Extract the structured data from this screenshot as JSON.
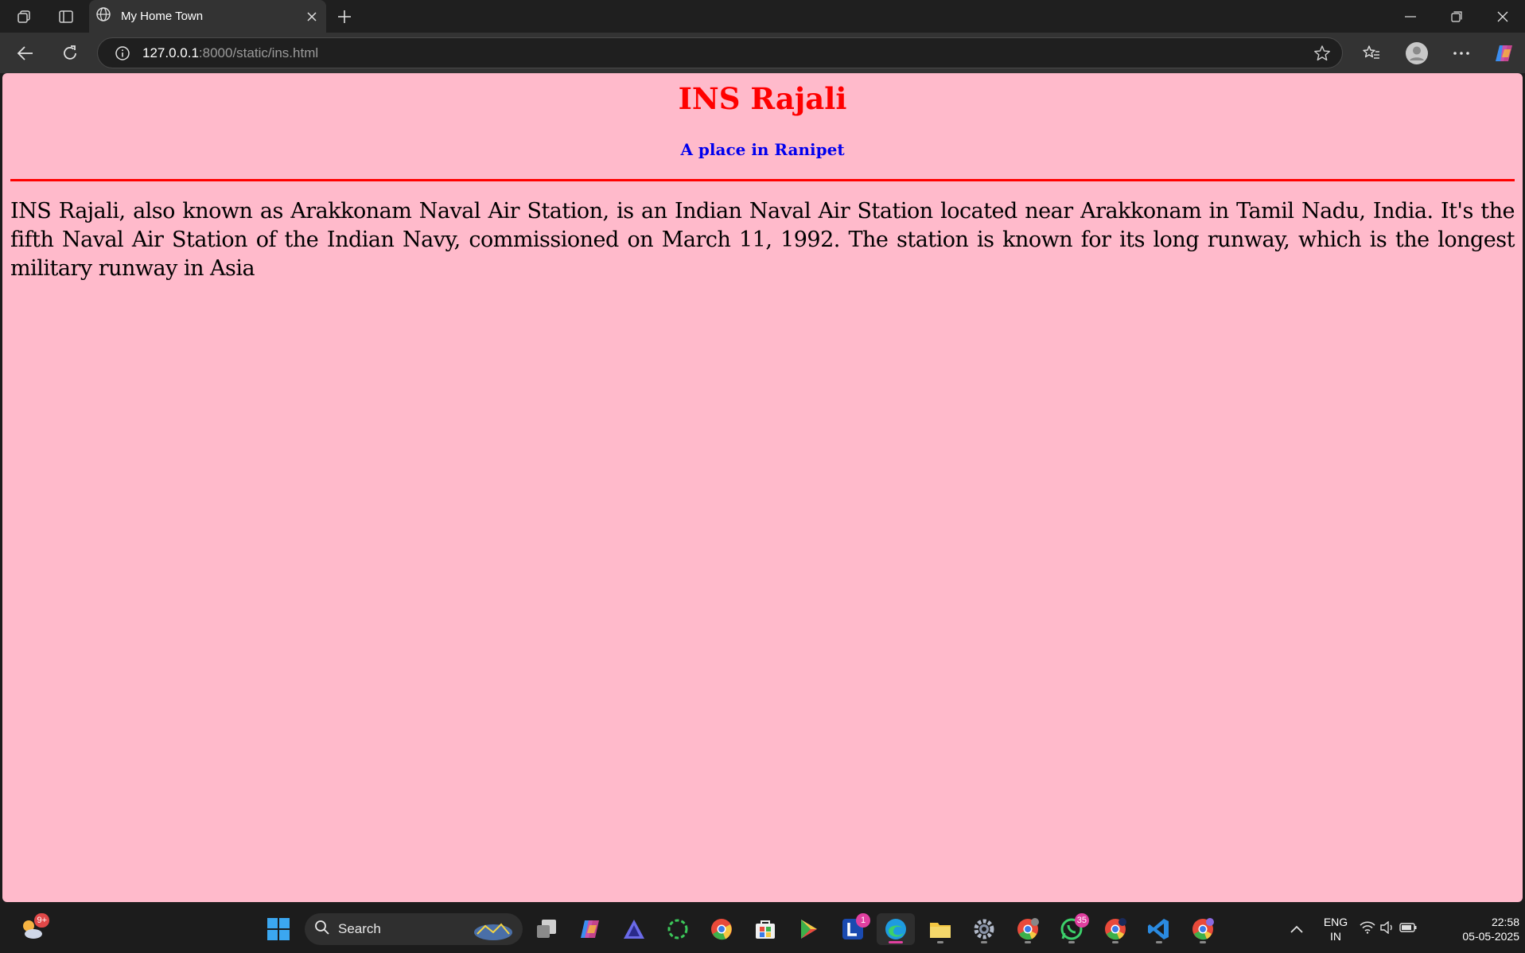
{
  "browser": {
    "tab_title": "My Home Town",
    "url_host": "127.0.0.1",
    "url_rest": ":8000/static/ins.html"
  },
  "page": {
    "heading": "INS Rajali",
    "subheading": "A place in Ranipet",
    "paragraph": "INS Rajali, also known as Arakkonam Naval Air Station, is an Indian Naval Air Station located near Arakkonam in Tamil Nadu, India. It's the fifth Naval Air Station of the Indian Navy, commissioned on March 11, 1992. The station is known for its long runway, which is the longest military runway in Asia",
    "background_color": "#ffbacb",
    "heading_color": "#ff0000",
    "subheading_color": "#0000ee"
  },
  "taskbar": {
    "search_label": "Search",
    "weather_badge": "9+",
    "l_app_badge": "1",
    "whatsapp_badge": "35",
    "lang_line1": "ENG",
    "lang_line2": "IN",
    "time": "22:58",
    "date": "05-05-2025"
  }
}
